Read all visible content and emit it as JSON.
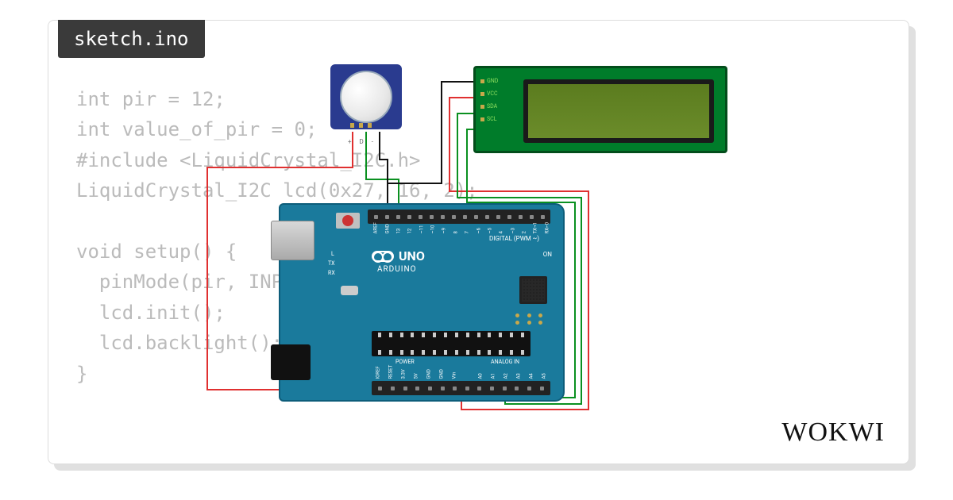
{
  "tab": {
    "filename": "sketch.ino"
  },
  "code": {
    "text": "int pir = 12;\nint value_of_pir = 0;\n#include <LiquidCrystal_I2C.h>\nLiquidCrystal_I2C lcd(0x27, 16, 2);\n\nvoid setup() {\n  pinMode(pir, INPUT);\n  lcd.init();\n  lcd.backlight();\n}"
  },
  "logo": {
    "text": "WOKWI"
  },
  "arduino": {
    "logo_text": "UNO",
    "brand": "ARDUINO",
    "digital": "DIGITAL (PWM ~)",
    "power": "POWER",
    "analog": "ANALOG IN",
    "on": "ON",
    "tx": "TX",
    "rx": "RX",
    "l": "L",
    "top_pins": [
      "AREF",
      "GND",
      "13",
      "12",
      "~11",
      "~10",
      "~9",
      "8",
      "7",
      "~6",
      "~5",
      "4",
      "~3",
      "2",
      "TX→1",
      "RX←0"
    ],
    "bottom_pins": [
      "IOREF",
      "RESET",
      "3.3V",
      "5V",
      "GND",
      "GND",
      "Vin",
      "",
      "A0",
      "A1",
      "A2",
      "A3",
      "A4",
      "A5"
    ]
  },
  "pir": {
    "pin_labels": "+ D -"
  },
  "lcd": {
    "pins": [
      "GND",
      "VCC",
      "SDA",
      "SCL"
    ]
  },
  "wires": [
    {
      "from": "pir.vcc",
      "to": "arduino.5v",
      "color": "red"
    },
    {
      "from": "pir.gnd",
      "to": "arduino.gnd",
      "color": "black"
    },
    {
      "from": "pir.d",
      "to": "arduino.d12",
      "color": "green"
    },
    {
      "from": "lcd.gnd",
      "to": "arduino.gnd",
      "color": "black"
    },
    {
      "from": "lcd.vcc",
      "to": "arduino.5v",
      "color": "red"
    },
    {
      "from": "lcd.sda",
      "to": "arduino.a4",
      "color": "green"
    },
    {
      "from": "lcd.scl",
      "to": "arduino.a5",
      "color": "green"
    }
  ]
}
